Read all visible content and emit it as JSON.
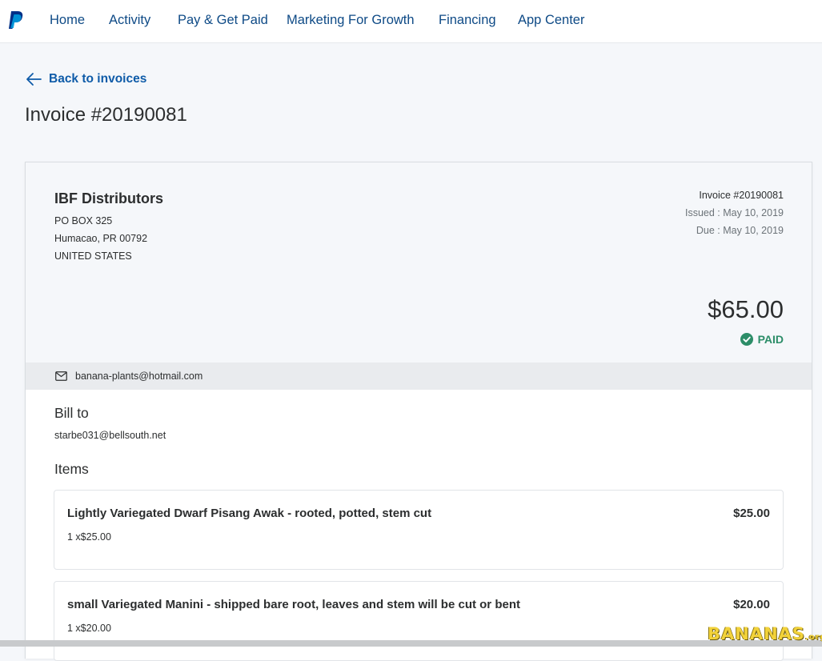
{
  "nav": {
    "items": [
      "Home",
      "Activity",
      "Pay & Get Paid",
      "Marketing For Growth",
      "Financing",
      "App Center"
    ]
  },
  "back_link": "Back to invoices",
  "page_title": "Invoice #20190081",
  "invoice": {
    "from": {
      "name": "IBF Distributors",
      "address_line1": "PO BOX 325",
      "address_line2": "Humacao, PR 00792",
      "country": "UNITED STATES"
    },
    "number_label": "Invoice #20190081",
    "issued": "Issued : May 10, 2019",
    "due": "Due : May 10, 2019",
    "amount": "$65.00",
    "status": "PAID",
    "seller_email": "banana-plants@hotmail.com",
    "bill_to_heading": "Bill to",
    "bill_to_email": "starbe031@bellsouth.net",
    "items_heading": "Items",
    "items": [
      {
        "name": "Lightly Variegated Dwarf Pisang Awak - rooted, potted, stem cut",
        "price": "$25.00",
        "qty": "1 x$25.00"
      },
      {
        "name": "small Variegated Manini - shipped bare root, leaves and stem will be cut or bent",
        "price": "$20.00",
        "qty": "1 x$20.00"
      }
    ]
  },
  "watermark": {
    "main": "BANANAS",
    "suffix": ".org"
  },
  "colors": {
    "nav_link": "#0e4a86",
    "paid_green": "#2c8d68",
    "page_bg": "#f5f7fa",
    "paypal_dark": "#003087",
    "paypal_light": "#009cde"
  },
  "icons": [
    "paypal-logo-icon",
    "arrow-left-icon",
    "check-circle-icon",
    "envelope-icon"
  ]
}
